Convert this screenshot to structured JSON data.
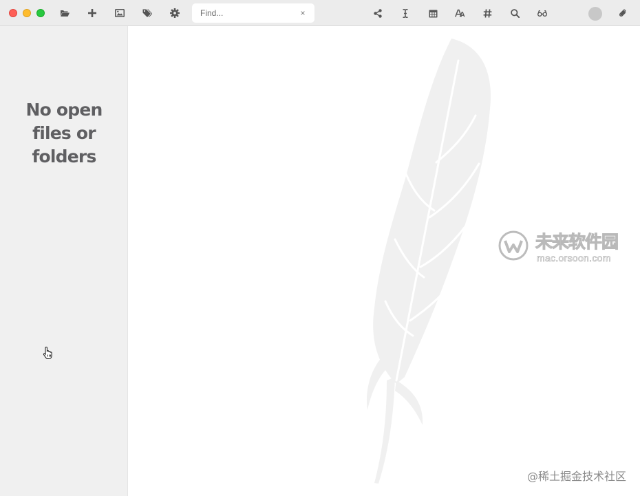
{
  "toolbar": {
    "find": {
      "placeholder": "Find...",
      "value": "",
      "clear_symbol": "×"
    },
    "left_icons": [
      "folder-open-icon",
      "plus-icon",
      "image-icon",
      "tags-icon",
      "gear-icon"
    ],
    "right_icons": [
      "share-icon",
      "text-cursor-icon",
      "calendar-icon",
      "font-size-icon",
      "hashtag-icon",
      "search-icon",
      "glasses-icon",
      "avatar",
      "paperclip-icon"
    ]
  },
  "sidebar": {
    "empty_message": "No open files or folders"
  },
  "editor": {
    "background_art": "feather-icon",
    "watermark": {
      "brand_cn": "未来软件园",
      "brand_url": "mac.orsoon.com",
      "footer": "@稀土掘金技术社区"
    }
  },
  "colors": {
    "toolbar_bg": "#ececec",
    "sidebar_bg": "#f0f0f0",
    "editor_bg": "#ffffff",
    "icon": "#555555",
    "sidebar_text": "#5f5f62",
    "feather": "#f0f0f0",
    "traffic_close": "#fe5f57",
    "traffic_min": "#febc2e",
    "traffic_max": "#28c840"
  }
}
